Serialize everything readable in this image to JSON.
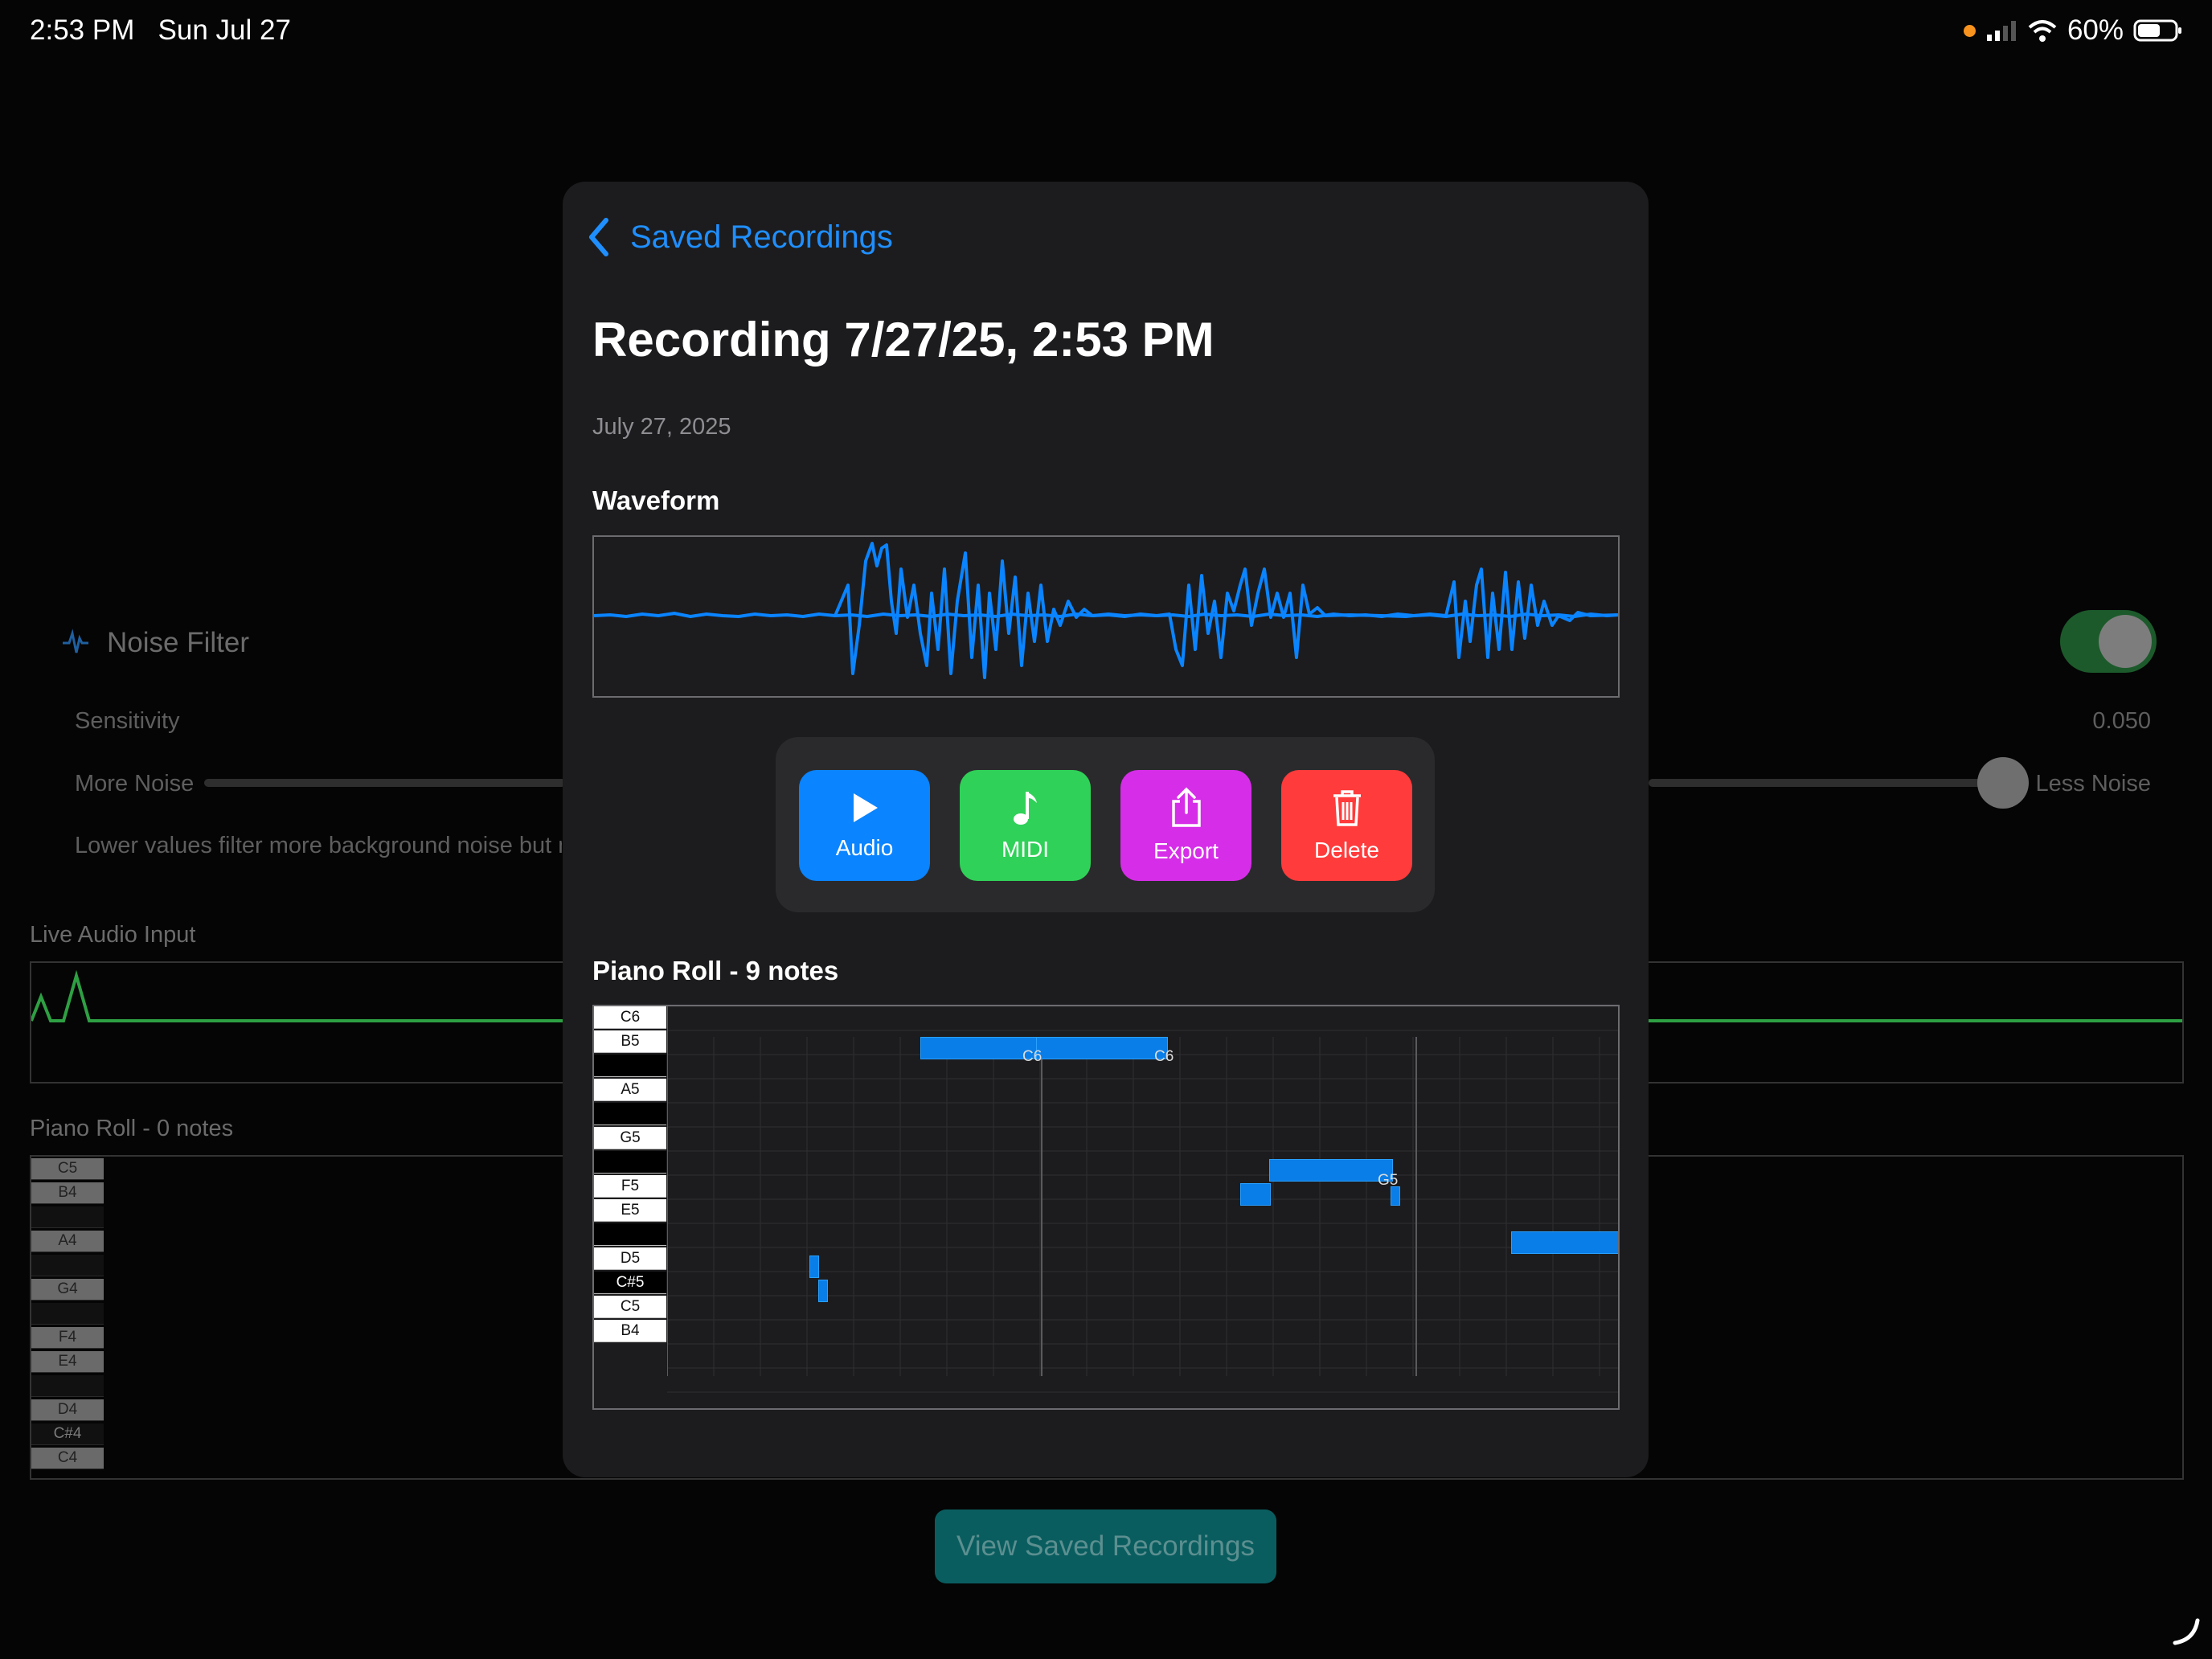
{
  "status_bar": {
    "time": "2:53 PM",
    "date": "Sun Jul 27",
    "battery": "60%"
  },
  "background": {
    "noise_filter": {
      "title": "Noise Filter",
      "sensitivity_label": "Sensitivity",
      "sensitivity_value": "0.050",
      "more_noise": "More Noise",
      "less_noise": "Less Noise",
      "hint": "Lower values filter more background noise but ma",
      "enabled": true
    },
    "live_audio_title": "Live Audio Input",
    "piano_roll_title": "Piano Roll - 0 notes",
    "piano_keys": [
      {
        "label": "C5",
        "black": false
      },
      {
        "label": "B4",
        "black": false
      },
      {
        "label": "",
        "black": true
      },
      {
        "label": "A4",
        "black": false
      },
      {
        "label": "",
        "black": true
      },
      {
        "label": "G4",
        "black": false
      },
      {
        "label": "",
        "black": true
      },
      {
        "label": "F4",
        "black": false
      },
      {
        "label": "E4",
        "black": false
      },
      {
        "label": "",
        "black": true
      },
      {
        "label": "D4",
        "black": false
      },
      {
        "label": "C#4",
        "black": true
      },
      {
        "label": "C4",
        "black": false
      }
    ],
    "view_saved_button": "View Saved Recordings"
  },
  "modal": {
    "back_label": "Saved Recordings",
    "title": "Recording 7/27/25, 2:53 PM",
    "date": "July 27, 2025",
    "waveform_title": "Waveform",
    "buttons": [
      {
        "label": "Audio",
        "icon": "play-icon",
        "color": "#0a84ff"
      },
      {
        "label": "MIDI",
        "icon": "music-note-icon",
        "color": "#30d158"
      },
      {
        "label": "Export",
        "icon": "share-icon",
        "color": "#d62de8"
      },
      {
        "label": "Delete",
        "icon": "trash-icon",
        "color": "#ff3b3b"
      }
    ],
    "piano_roll_title": "Piano Roll - 9 notes",
    "piano_keys": [
      {
        "label": "C6",
        "black": false
      },
      {
        "label": "B5",
        "black": false
      },
      {
        "label": "",
        "black": true
      },
      {
        "label": "A5",
        "black": false
      },
      {
        "label": "",
        "black": true
      },
      {
        "label": "G5",
        "black": false
      },
      {
        "label": "",
        "black": true
      },
      {
        "label": "F5",
        "black": false
      },
      {
        "label": "E5",
        "black": false
      },
      {
        "label": "",
        "black": true
      },
      {
        "label": "D5",
        "black": false
      },
      {
        "label": "C#5",
        "black": true
      },
      {
        "label": "C5",
        "black": false
      },
      {
        "label": "B4",
        "black": false
      }
    ],
    "note_labels": [
      "C6",
      "C6",
      "G5"
    ]
  },
  "colors": {
    "accent": "#0a84ff",
    "toggle_on": "#30d158",
    "live_wave": "#2ea043"
  }
}
